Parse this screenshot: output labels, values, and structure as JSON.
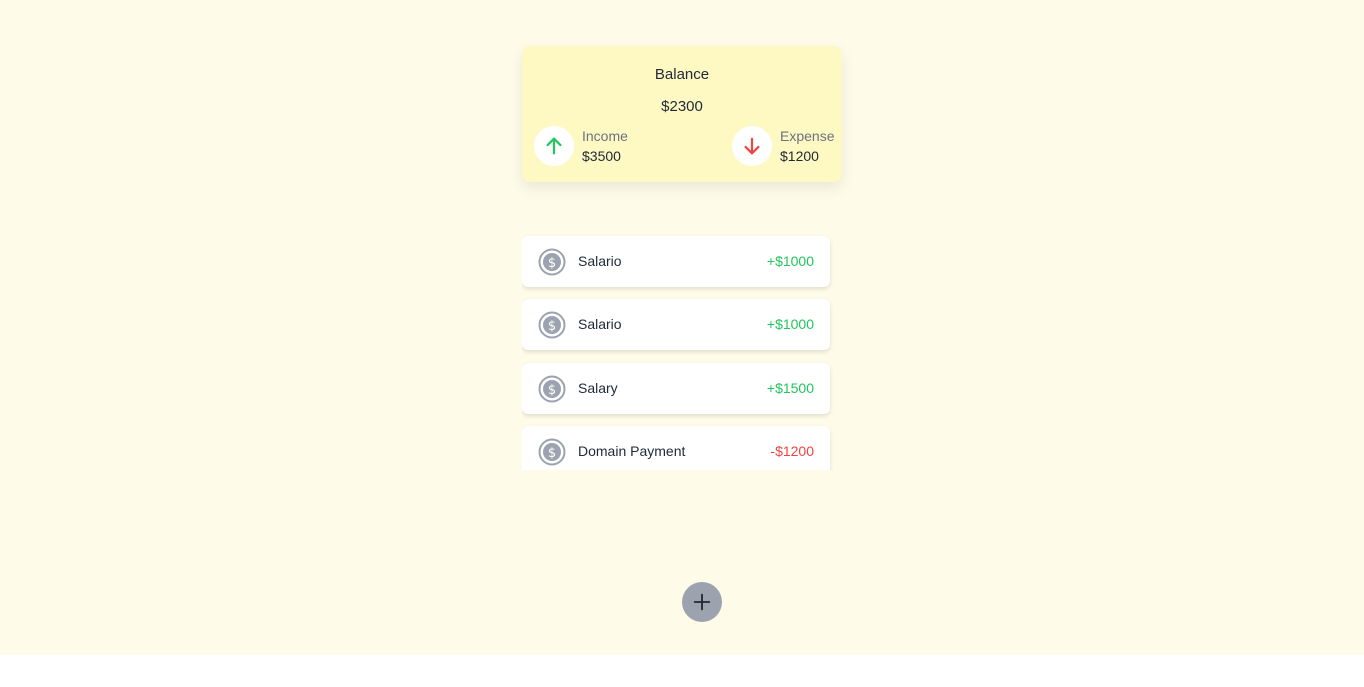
{
  "balance": {
    "title": "Balance",
    "amount": "$2300",
    "income": {
      "label": "Income",
      "value": "$3500",
      "icon": "arrow-up-icon",
      "color": "#22c55e"
    },
    "expense": {
      "label": "Expense",
      "value": "$1200",
      "icon": "arrow-down-icon",
      "color": "#ef4444"
    }
  },
  "transactions": [
    {
      "name": "Salario",
      "amount": "+$1000",
      "type": "income",
      "icon": "dollar-coin-icon"
    },
    {
      "name": "Salario",
      "amount": "+$1000",
      "type": "income",
      "icon": "dollar-coin-icon"
    },
    {
      "name": "Salary",
      "amount": "+$1500",
      "type": "income",
      "icon": "dollar-coin-icon"
    },
    {
      "name": "Domain Payment",
      "amount": "-$1200",
      "type": "expense",
      "icon": "dollar-coin-icon"
    }
  ],
  "colors": {
    "background": "#fefbe8",
    "card": "#fef9c3",
    "income": "#22c55e",
    "expense": "#ef4444",
    "icon_gray": "#9ca3af"
  },
  "add_button": {
    "icon": "plus-icon"
  }
}
